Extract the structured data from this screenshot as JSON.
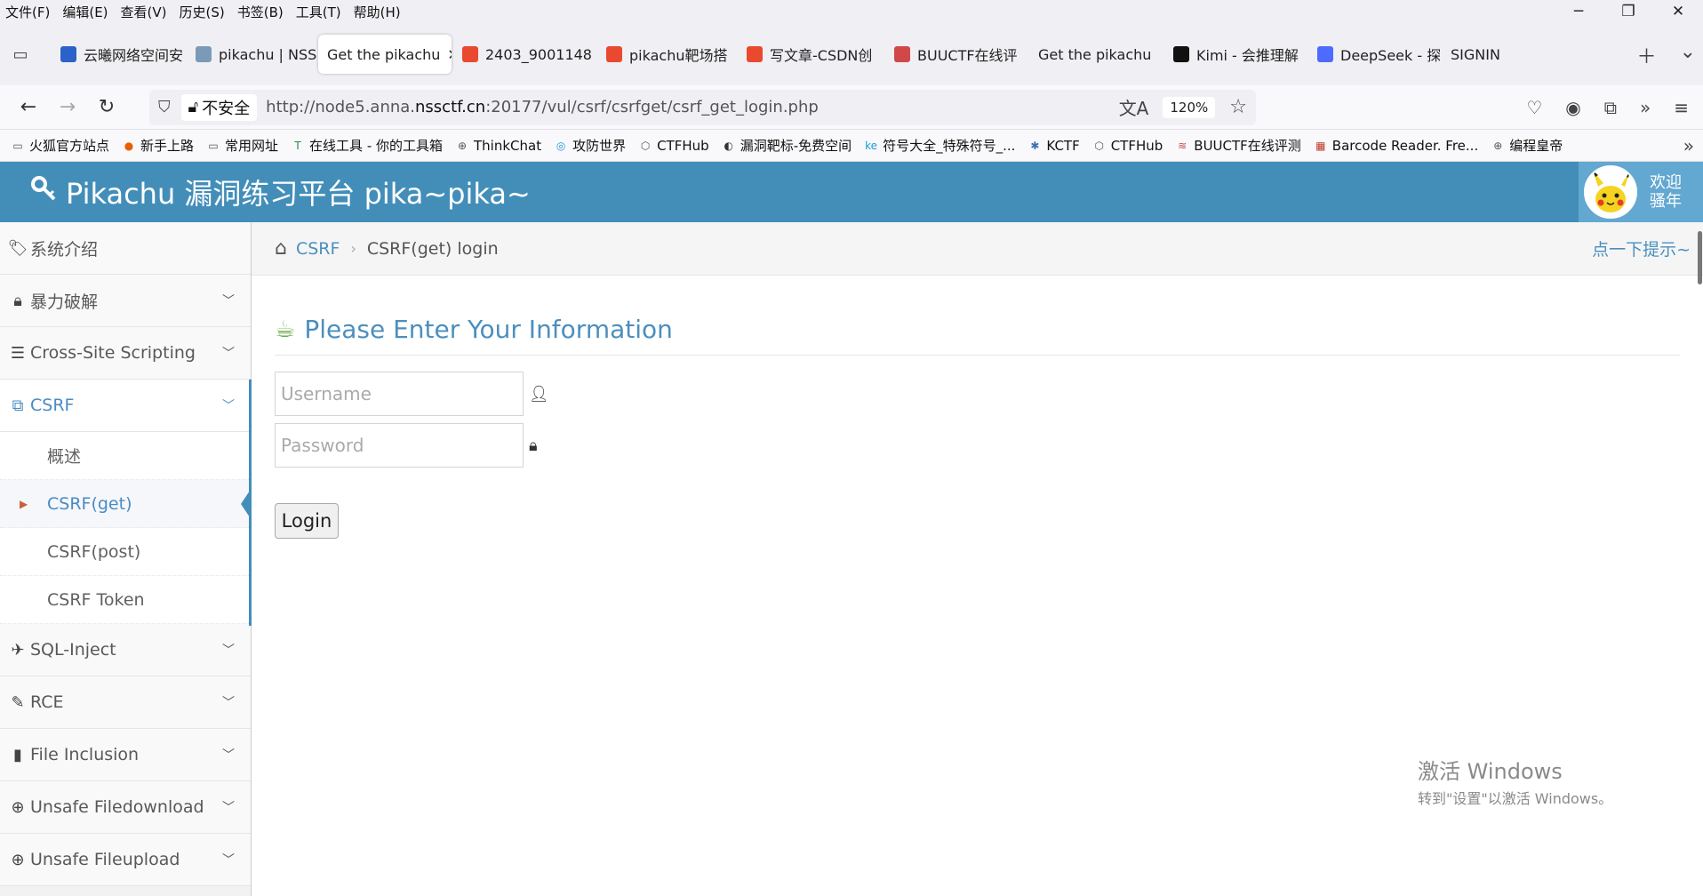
{
  "menubar": {
    "items": [
      "文件(F)",
      "编辑(E)",
      "查看(V)",
      "历史(S)",
      "书签(B)",
      "工具(T)",
      "帮助(H)"
    ],
    "window_controls": [
      "─",
      "❐",
      "✕"
    ]
  },
  "tabs": [
    {
      "label": "云曦网络空间安",
      "icon": "globe-icon",
      "color": "#2a62c9",
      "active": false
    },
    {
      "label": "pikachu | NSSC",
      "icon": "page-icon",
      "color": "#7a9ab8",
      "active": false
    },
    {
      "label": "Get the pikachu",
      "icon": "",
      "color": "",
      "active": true
    },
    {
      "label": "2403_9001148",
      "icon": "csdn-icon",
      "color": "#e8492f",
      "active": false
    },
    {
      "label": "pikachu靶场搭",
      "icon": "csdn-icon",
      "color": "#e8492f",
      "active": false
    },
    {
      "label": "写文章-CSDN创",
      "icon": "csdn-icon",
      "color": "#e8492f",
      "active": false
    },
    {
      "label": "BUUCTF在线评",
      "icon": "buuctf-icon",
      "color": "#d04848",
      "active": false
    },
    {
      "label": "Get the pikachu",
      "icon": "",
      "color": "",
      "active": false
    },
    {
      "label": "Kimi - 会推理解",
      "icon": "kimi-icon",
      "color": "#111111",
      "active": false
    },
    {
      "label": "DeepSeek - 探",
      "icon": "deepseek-icon",
      "color": "#4d6bfe",
      "active": false
    },
    {
      "label": "SIGNIN",
      "icon": "",
      "color": "",
      "active": false
    }
  ],
  "tab_close": "✕",
  "nav": {
    "insecure_label": "不安全",
    "url_prefix": "http://node5.anna.",
    "url_domain": "nssctf.cn",
    "url_suffix": ":20177/vul/csrf/csrfget/csrf_get_login.php",
    "zoom": "120%"
  },
  "bookmarks": [
    {
      "label": "火狐官方站点",
      "icon": "folder-icon"
    },
    {
      "label": "新手上路",
      "icon": "firefox-icon"
    },
    {
      "label": "常用网址",
      "icon": "folder-icon"
    },
    {
      "label": "在线工具 - 你的工具箱",
      "icon": "tool-icon"
    },
    {
      "label": "ThinkChat",
      "icon": "globe-icon"
    },
    {
      "label": "攻防世界",
      "icon": "adworld-icon"
    },
    {
      "label": "CTFHub",
      "icon": "ctfhub-icon"
    },
    {
      "label": "漏洞靶标-免费空间",
      "icon": "target-icon"
    },
    {
      "label": "符号大全_特殊符号_...",
      "icon": "ke-icon"
    },
    {
      "label": "KCTF",
      "icon": "snowflake-icon"
    },
    {
      "label": "CTFHub",
      "icon": "ctfhub-icon"
    },
    {
      "label": "BUUCTF在线评测",
      "icon": "buuctf-icon"
    },
    {
      "label": "Barcode Reader. Fre...",
      "icon": "barcode-icon"
    },
    {
      "label": "编程皇帝",
      "icon": "globe-icon"
    }
  ],
  "header": {
    "title": "Pikachu 漏洞练习平台 pika~pika~",
    "welcome_line1": "欢迎",
    "welcome_line2": "骚年"
  },
  "sidebar": {
    "items": [
      {
        "label": "系统介绍",
        "icon": "tags-icon",
        "chevron": false
      },
      {
        "label": "暴力破解",
        "icon": "lock-icon",
        "chevron": true
      },
      {
        "label": "Cross-Site Scripting",
        "icon": "list-icon",
        "chevron": true
      },
      {
        "label": "CSRF",
        "icon": "share-icon",
        "chevron": true,
        "open": true
      },
      {
        "label": "SQL-Inject",
        "icon": "plane-icon",
        "chevron": true
      },
      {
        "label": "RCE",
        "icon": "pencil-icon",
        "chevron": true
      },
      {
        "label": "File Inclusion",
        "icon": "file-icon",
        "chevron": true
      },
      {
        "label": "Unsafe Filedownload",
        "icon": "download-icon",
        "chevron": true
      },
      {
        "label": "Unsafe Fileupload",
        "icon": "upload-icon",
        "chevron": true
      }
    ],
    "csrf_subitems": [
      {
        "label": "概述",
        "active": false
      },
      {
        "label": "CSRF(get)",
        "active": true
      },
      {
        "label": "CSRF(post)",
        "active": false
      },
      {
        "label": "CSRF Token",
        "active": false
      }
    ]
  },
  "breadcrumb": {
    "link": "CSRF",
    "current": "CSRF(get) login",
    "hint": "点一下提示~"
  },
  "form": {
    "title": "Please Enter Your Information",
    "username_placeholder": "Username",
    "password_placeholder": "Password",
    "login_label": "Login"
  },
  "watermark": {
    "line1": "激活 Windows",
    "line2": "转到\"设置\"以激活 Windows。"
  },
  "colors": {
    "header_bg": "#438eb9",
    "accent": "#4c8fbd",
    "active_caret": "#c86139"
  }
}
